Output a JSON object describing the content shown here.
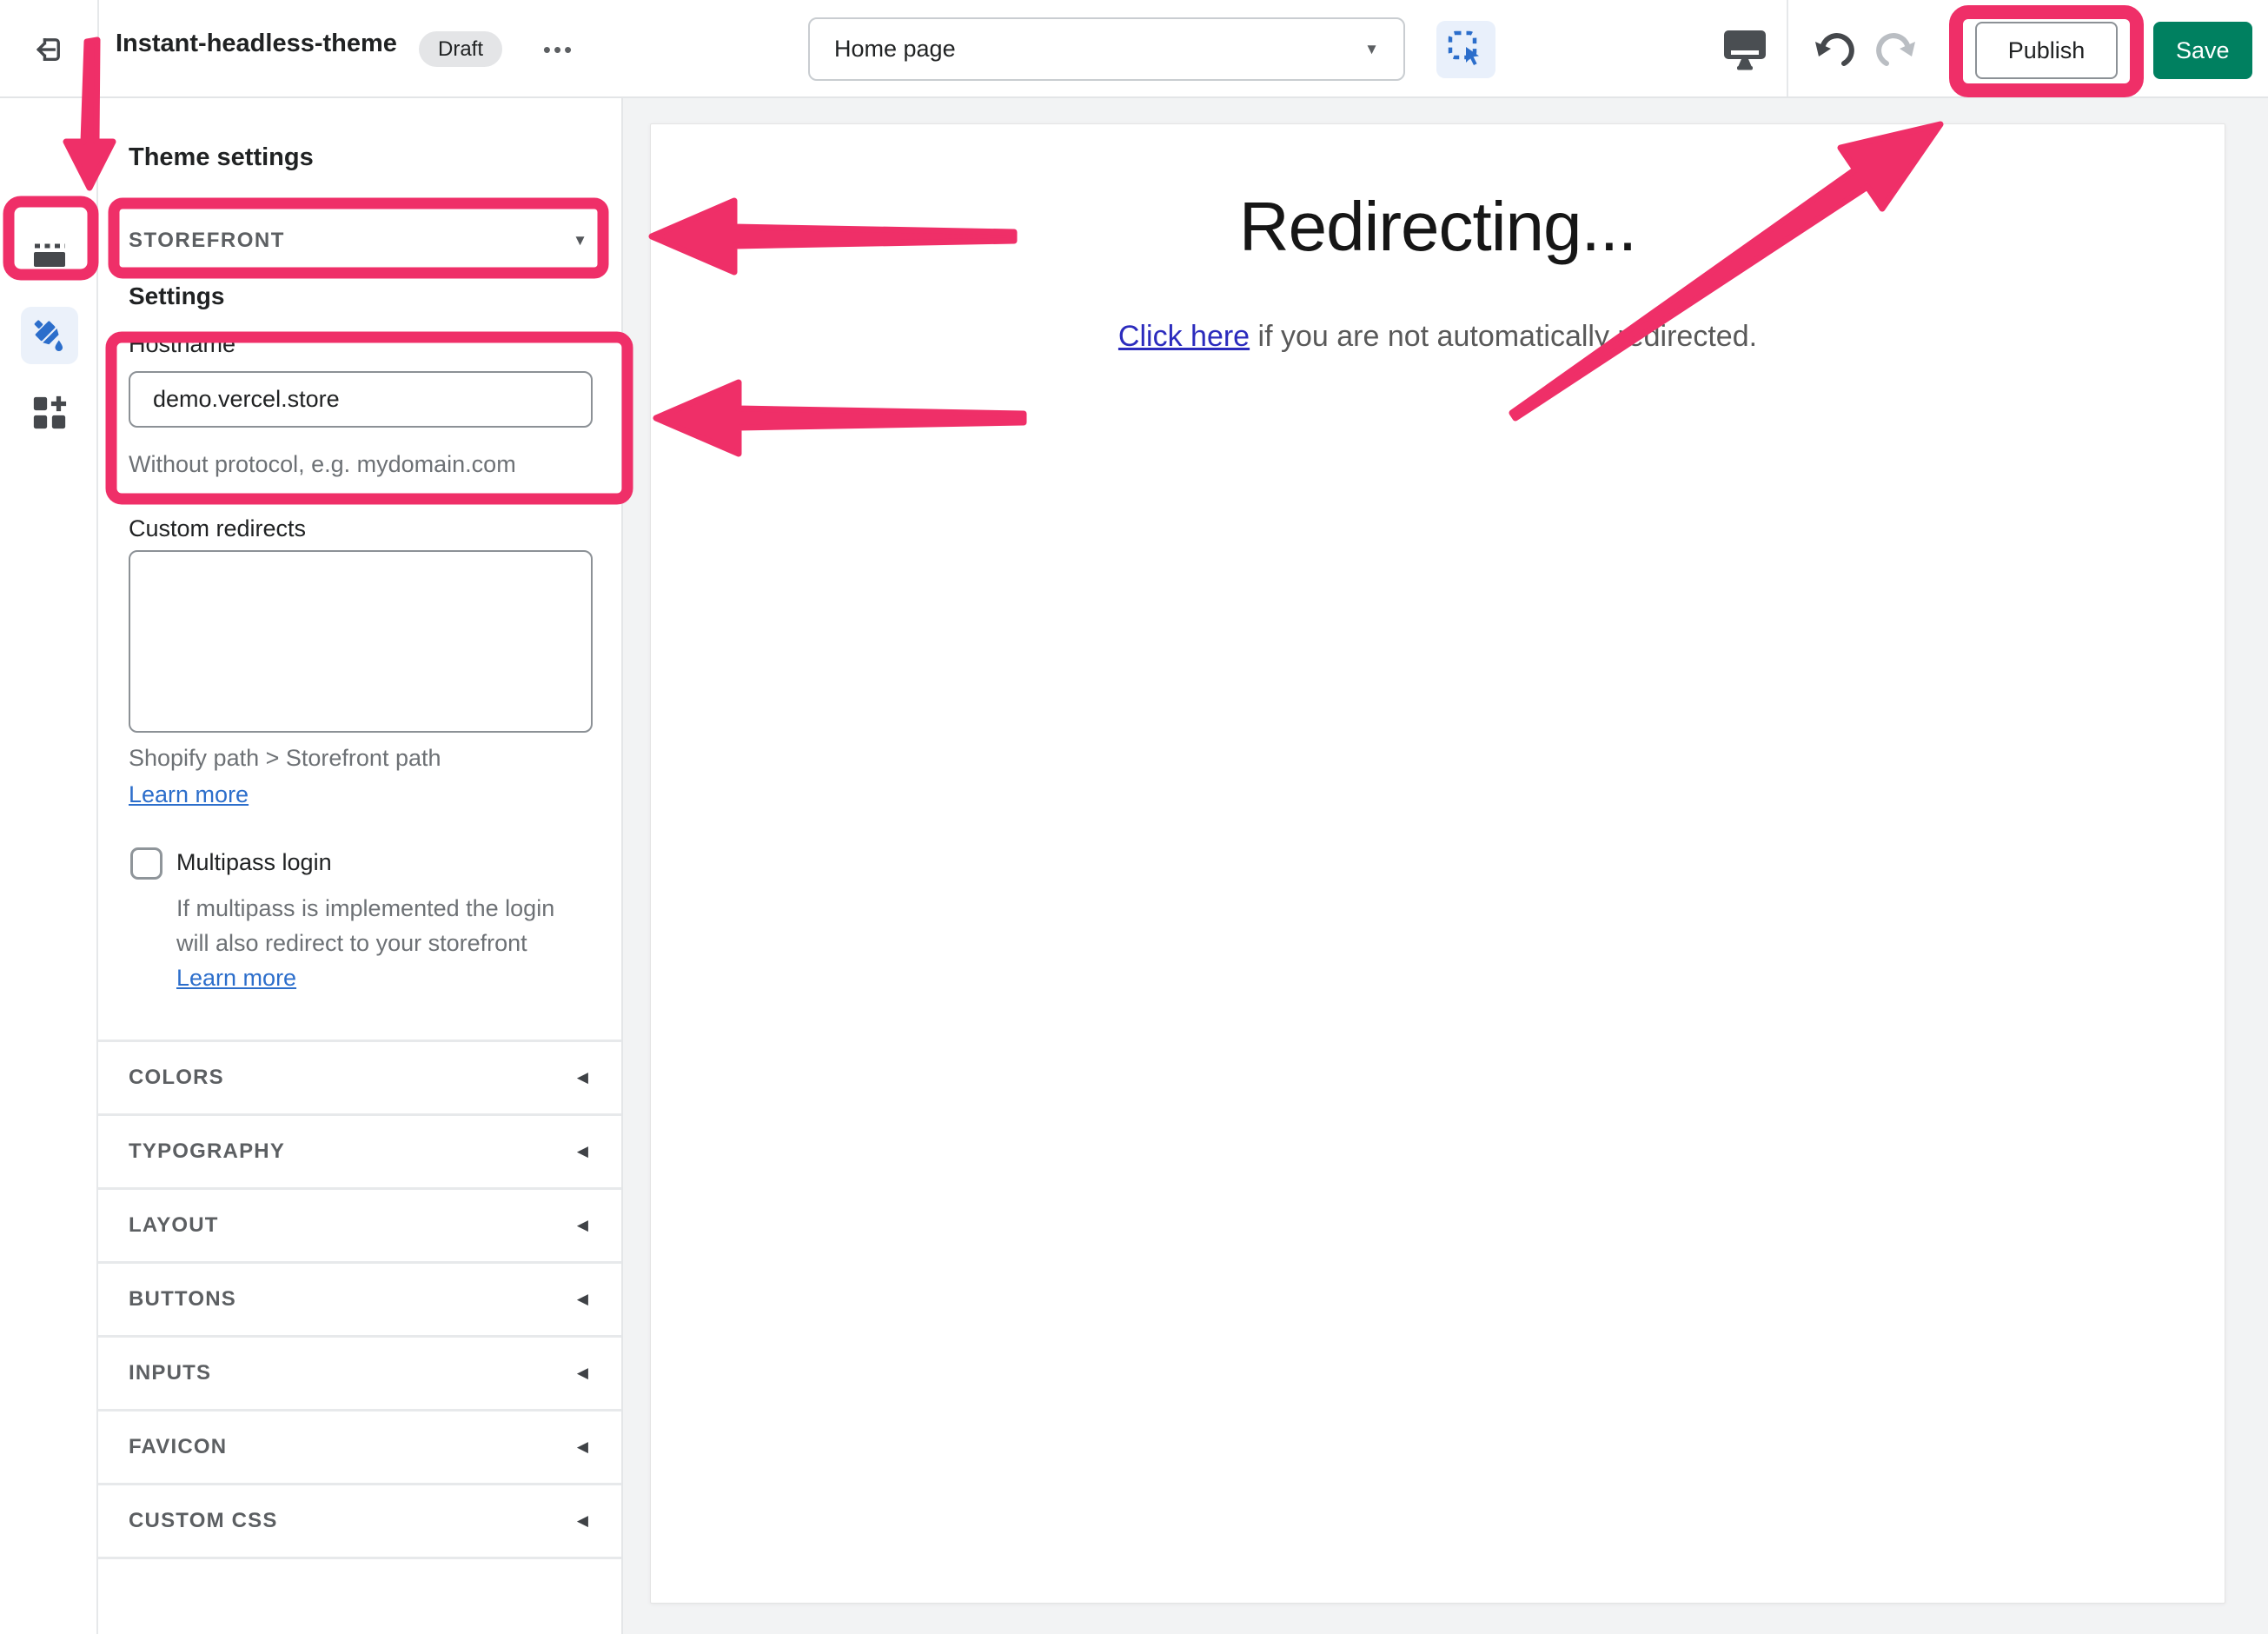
{
  "topbar": {
    "theme_name": "Instant-headless-theme",
    "status_badge": "Draft",
    "page_selector_value": "Home page",
    "publish_label": "Publish",
    "save_label": "Save"
  },
  "icons": {
    "overflow": "•••",
    "dropdown_caret": "▼",
    "collapsed_caret": "◀"
  },
  "sidebar": {
    "title": "Theme settings",
    "storefront_header": "STOREFRONT",
    "settings_subheading": "Settings",
    "hostname": {
      "label": "Hostname",
      "value": "demo.vercel.store",
      "helper": "Without protocol, e.g. mydomain.com"
    },
    "custom_redirects": {
      "label": "Custom redirects",
      "value": "",
      "helper": "Shopify path > Storefront path",
      "learn_more": "Learn more"
    },
    "multipass": {
      "label": "Multipass login",
      "checked": false,
      "description": "If multipass is implemented the login will also redirect to your storefront ",
      "learn_more": "Learn more"
    },
    "sections": [
      {
        "label": "COLORS"
      },
      {
        "label": "TYPOGRAPHY"
      },
      {
        "label": "LAYOUT"
      },
      {
        "label": "BUTTONS"
      },
      {
        "label": "INPUTS"
      },
      {
        "label": "FAVICON"
      },
      {
        "label": "CUSTOM CSS"
      }
    ]
  },
  "preview": {
    "heading": "Redirecting...",
    "link_text": "Click here",
    "rest_text": " if you are not automatically redirected."
  },
  "colors": {
    "annotation_pink": "#ef2f68",
    "save_green": "#008060",
    "accent_blue": "#2c6ecb"
  }
}
